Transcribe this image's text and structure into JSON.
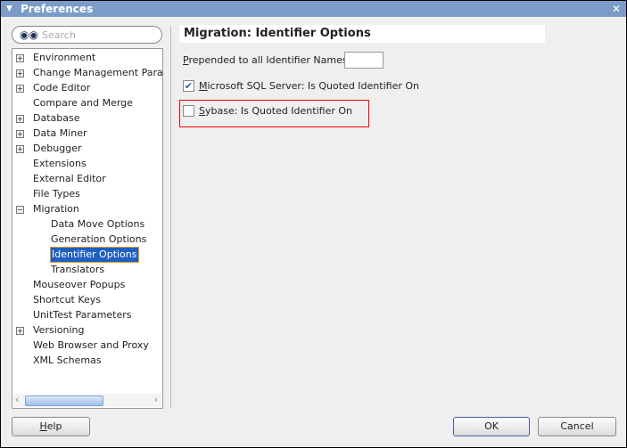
{
  "window": {
    "title": "Preferences",
    "close": "✕"
  },
  "search": {
    "placeholder": "Search"
  },
  "tree": [
    {
      "label": "Environment",
      "expander": "+",
      "level": 0
    },
    {
      "label": "Change Management Param",
      "expander": "+",
      "level": 0
    },
    {
      "label": "Code Editor",
      "expander": "+",
      "level": 0
    },
    {
      "label": "Compare and Merge",
      "expander": "",
      "level": 0
    },
    {
      "label": "Database",
      "expander": "+",
      "level": 0
    },
    {
      "label": "Data Miner",
      "expander": "+",
      "level": 0
    },
    {
      "label": "Debugger",
      "expander": "+",
      "level": 0
    },
    {
      "label": "Extensions",
      "expander": "",
      "level": 0
    },
    {
      "label": "External Editor",
      "expander": "",
      "level": 0
    },
    {
      "label": "File Types",
      "expander": "",
      "level": 0
    },
    {
      "label": "Migration",
      "expander": "−",
      "level": 0
    },
    {
      "label": "Data Move Options",
      "expander": "",
      "level": 1
    },
    {
      "label": "Generation Options",
      "expander": "",
      "level": 1
    },
    {
      "label": "Identifier Options",
      "expander": "",
      "level": 1,
      "selected": true
    },
    {
      "label": "Translators",
      "expander": "",
      "level": 1
    },
    {
      "label": "Mouseover Popups",
      "expander": "",
      "level": 0
    },
    {
      "label": "Shortcut Keys",
      "expander": "",
      "level": 0
    },
    {
      "label": "UnitTest Parameters",
      "expander": "",
      "level": 0
    },
    {
      "label": "Versioning",
      "expander": "+",
      "level": 0
    },
    {
      "label": "Web Browser and Proxy",
      "expander": "",
      "level": 0
    },
    {
      "label": "XML Schemas",
      "expander": "",
      "level": 0
    }
  ],
  "panel": {
    "title": "Migration: Identifier Options",
    "prepend_mnemonic": "P",
    "prepend_label": "repended to all Identifier Names",
    "prepend_value": "",
    "mssql_mnemonic": "M",
    "mssql_label": "icrosoft SQL Server: Is Quoted Identifier On",
    "mssql_checked": true,
    "sybase_mnemonic": "S",
    "sybase_label": "ybase: Is Quoted Identifier On",
    "sybase_checked": false
  },
  "buttons": {
    "help_mnemonic": "H",
    "help": "elp",
    "ok": "OK",
    "cancel": "Cancel"
  }
}
